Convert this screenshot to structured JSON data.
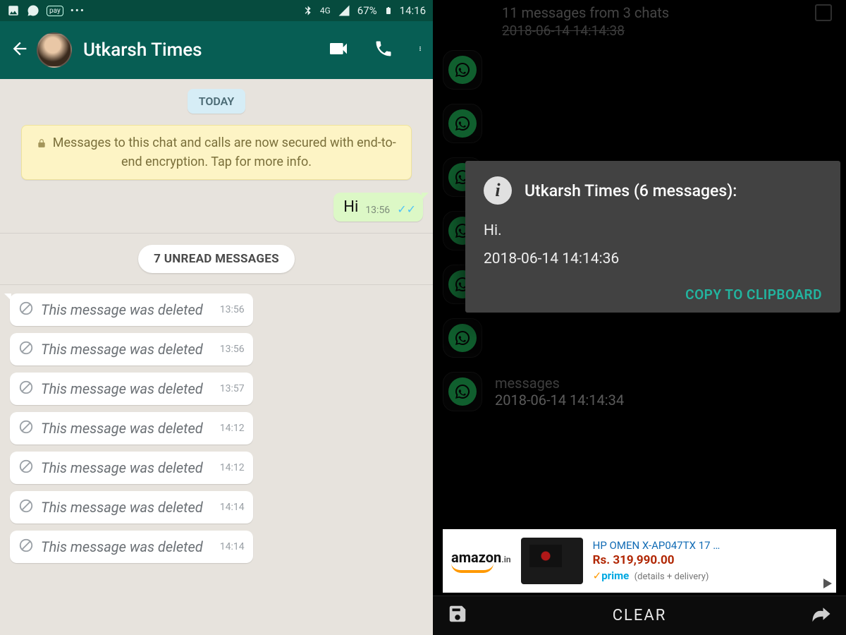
{
  "status": {
    "battery": "67%",
    "time": "14:16",
    "net": "4G"
  },
  "chat": {
    "contact": "Utkarsh Times",
    "dateChip": "TODAY",
    "encryption": "Messages to this chat and calls are now secured with end-to-end encryption. Tap for more info.",
    "outgoing": {
      "text": "Hi",
      "time": "13:56"
    },
    "unread": "7 UNREAD MESSAGES",
    "deletedLabel": "This message was deleted",
    "incoming": [
      {
        "time": "13:56"
      },
      {
        "time": "13:56"
      },
      {
        "time": "13:57"
      },
      {
        "time": "14:12"
      },
      {
        "time": "14:12"
      },
      {
        "time": "14:14"
      },
      {
        "time": "14:14"
      }
    ]
  },
  "log": {
    "summary": "11 messages from 3 chats",
    "summaryTs": "2018-06-14 14:14:38",
    "rows": [
      {
        "ts": ""
      },
      {
        "ts": ""
      },
      {
        "ts": ""
      },
      {
        "ts": "2018-06-14 14:14:36"
      },
      {
        "ts": ""
      },
      {
        "ts": ""
      },
      {
        "ts": "2018-06-14 14:14:34",
        "extra": "messages"
      }
    ],
    "clear": "CLEAR"
  },
  "dialog": {
    "title": "Utkarsh Times (6 messages):",
    "line1": "Hi.",
    "line2": "2018-06-14 14:14:36",
    "action": "COPY TO CLIPBOARD"
  },
  "ad": {
    "brand": "amazon",
    "tld": ".in",
    "title": "HP OMEN X-AP047TX 17 …",
    "price": "Rs. 319,990.00",
    "prime": "prime",
    "details": "(details + delivery)"
  }
}
